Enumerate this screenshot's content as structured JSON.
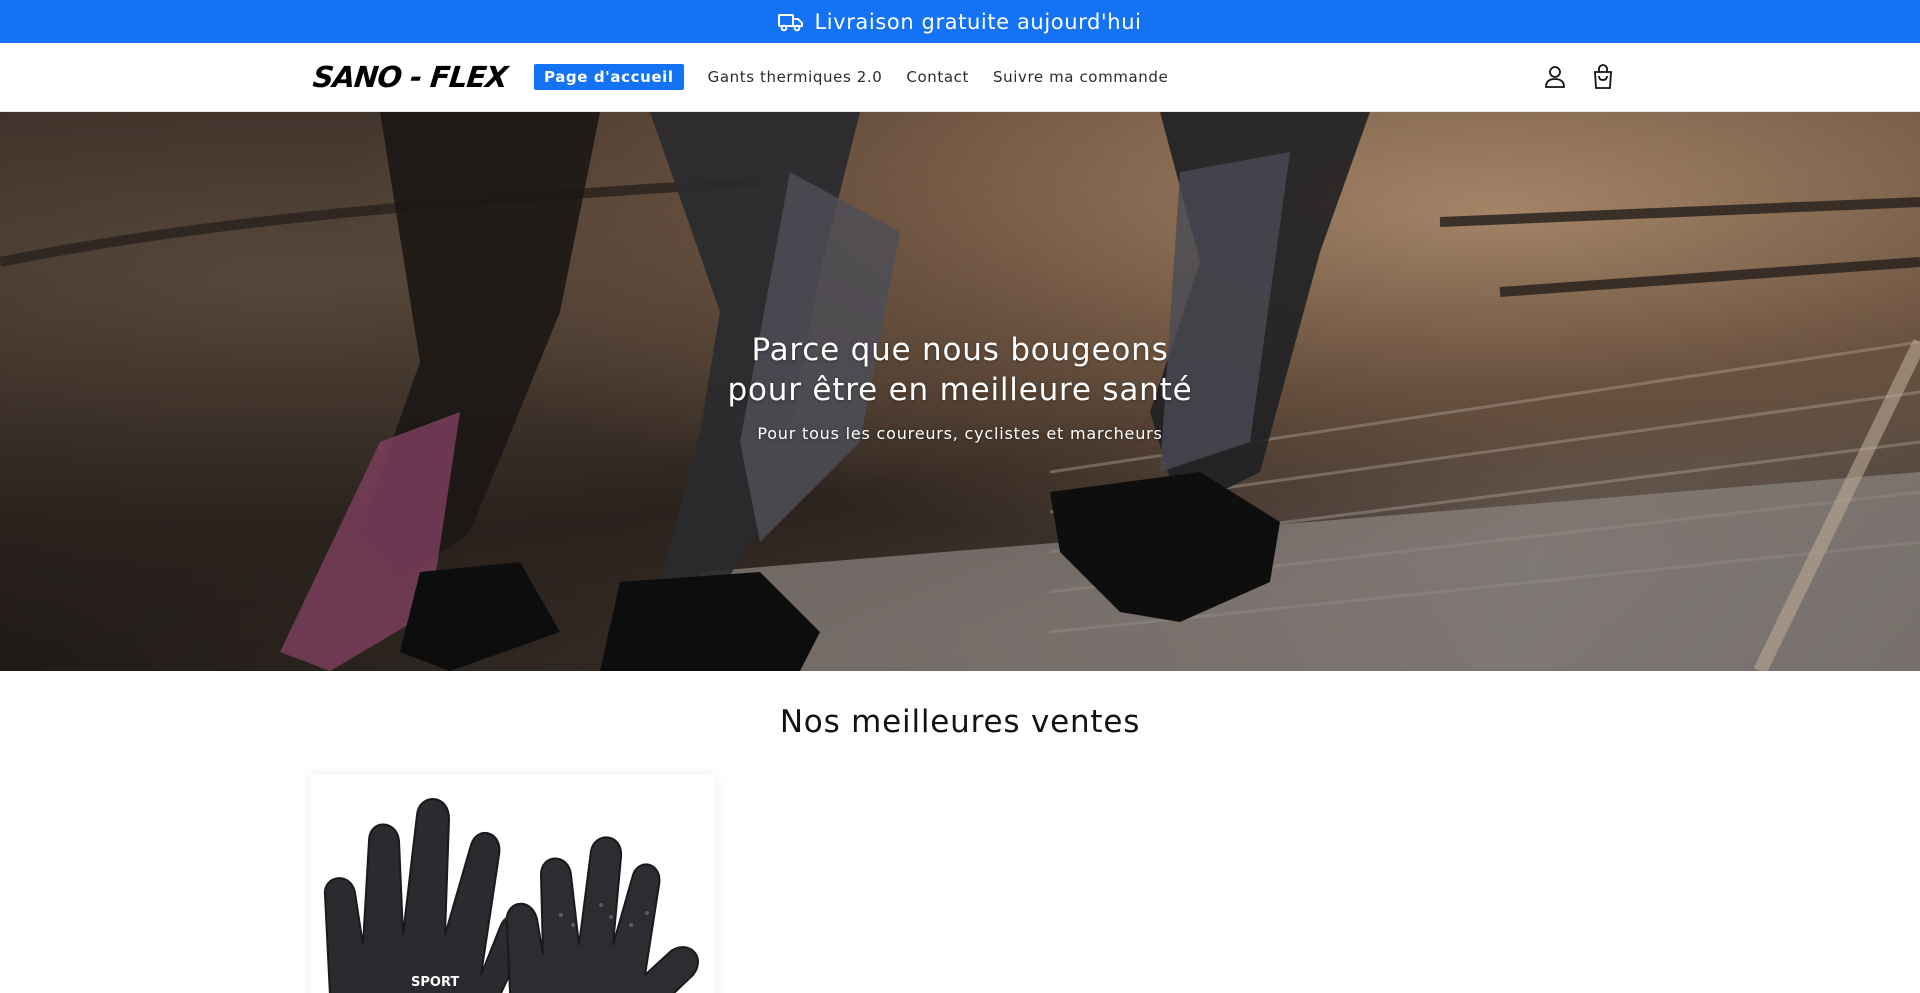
{
  "announcement": {
    "icon": "truck-icon",
    "text": "Livraison gratuite aujourd'hui",
    "background": "#1473f5"
  },
  "header": {
    "logo_text": "SANO - FLEX",
    "nav": [
      {
        "label": "Page d'accueil",
        "active": true
      },
      {
        "label": "Gants thermiques 2.0",
        "active": false
      },
      {
        "label": "Contact",
        "active": false
      },
      {
        "label": "Suivre ma commande",
        "active": false
      }
    ],
    "icons": [
      "account-icon",
      "cart-icon"
    ],
    "accent": "#1473f5"
  },
  "hero": {
    "title_line1": "Parce que nous bougeons",
    "title_line2": "pour être en meilleure santé",
    "subtitle": "Pour tous les coureurs, cyclistes et marcheurs"
  },
  "bestsellers": {
    "title": "Nos meilleures ventes",
    "product_image_text": "SPORT"
  }
}
